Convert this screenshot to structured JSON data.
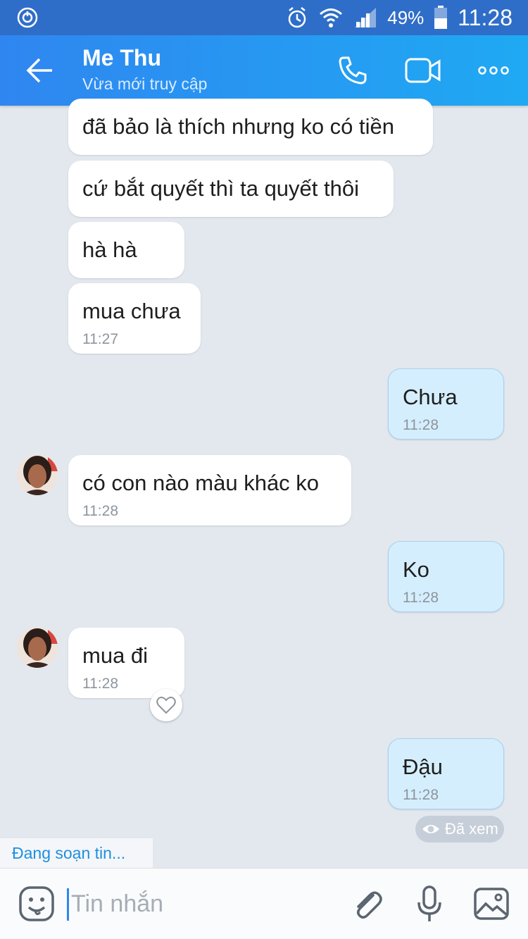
{
  "status_bar": {
    "battery": "49%",
    "time": "11:28"
  },
  "header": {
    "contact_name": "Me Thu",
    "contact_status": "Vừa mới truy cập"
  },
  "messages": [
    {
      "side": "in",
      "text": "đã bảo là thích nhưng ko có tiền",
      "time": ""
    },
    {
      "side": "in",
      "text": "cứ bắt quyết thì ta quyết thôi",
      "time": ""
    },
    {
      "side": "in",
      "text": "hà hà",
      "time": ""
    },
    {
      "side": "in",
      "text": "mua chưa",
      "time": "11:27"
    },
    {
      "side": "out",
      "text": "Chưa",
      "time": "11:28"
    },
    {
      "side": "in",
      "text": "có con nào màu khác ko",
      "time": "11:28"
    },
    {
      "side": "out",
      "text": "Ko",
      "time": "11:28"
    },
    {
      "side": "in",
      "text": "mua đi",
      "time": "11:28"
    },
    {
      "side": "out",
      "text": "Đậu",
      "time": "11:28"
    }
  ],
  "seen_label": "Đã xem",
  "typing_indicator": "Đang soạn tin...",
  "composer": {
    "placeholder": "Tin nhắn"
  },
  "colors": {
    "header_start": "#2f86f0",
    "header_end": "#1fa9f3",
    "outgoing_bubble": "#d5eefd",
    "background": "#e3e8ef"
  }
}
